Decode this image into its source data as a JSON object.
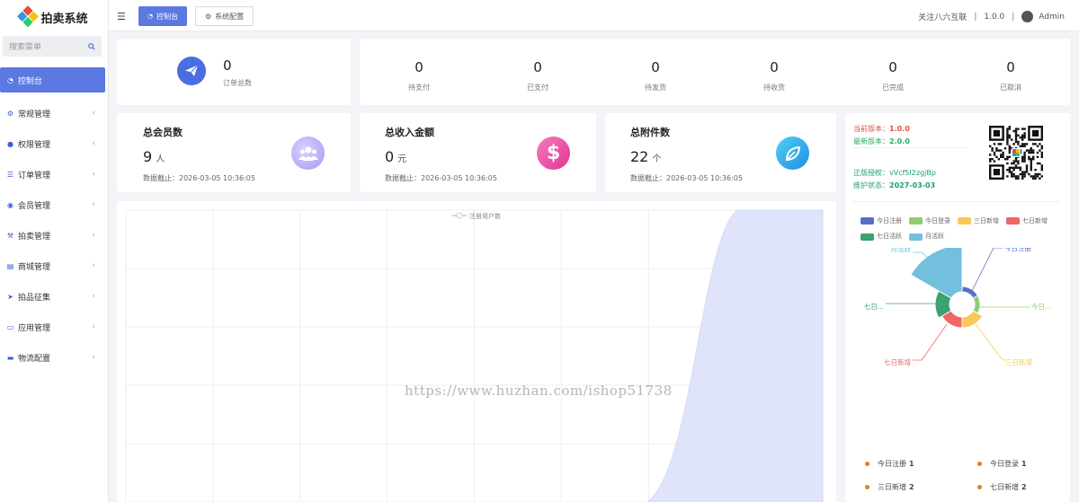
{
  "app": {
    "name": "拍卖系统"
  },
  "sidebar": {
    "search_placeholder": "搜索菜单",
    "items": [
      {
        "label": "控制台",
        "icon": "dashboard-icon",
        "active": true
      },
      {
        "label": "常规管理",
        "icon": "cogs-icon"
      },
      {
        "label": "权限管理",
        "icon": "users-icon"
      },
      {
        "label": "订单管理",
        "icon": "list-icon"
      },
      {
        "label": "会员管理",
        "icon": "user-circle-icon"
      },
      {
        "label": "拍卖管理",
        "icon": "gavel-icon"
      },
      {
        "label": "商城管理",
        "icon": "shopping-basket-icon"
      },
      {
        "label": "拍品征集",
        "icon": "paper-plane-icon"
      },
      {
        "label": "应用管理",
        "icon": "desktop-icon"
      },
      {
        "label": "物流配置",
        "icon": "truck-icon"
      }
    ]
  },
  "topbar": {
    "tabs": [
      {
        "label": "控制台",
        "active": true
      },
      {
        "label": "系统配置"
      }
    ],
    "follow": "关注八六互联",
    "version": "1.0.0",
    "user": "Admin"
  },
  "orders_card": {
    "value": "0",
    "label": "订单总数"
  },
  "order_stats": [
    {
      "value": "0",
      "label": "待支付"
    },
    {
      "value": "0",
      "label": "已支付"
    },
    {
      "value": "0",
      "label": "待发货"
    },
    {
      "value": "0",
      "label": "待收货"
    },
    {
      "value": "0",
      "label": "已完成"
    },
    {
      "value": "0",
      "label": "已取消"
    }
  ],
  "summary": [
    {
      "title": "总会员数",
      "value": "9",
      "unit": "人",
      "deadline": "数据截止：2026-03-05 10:36:05",
      "color": "#b3a6f5"
    },
    {
      "title": "总收入金额",
      "value": "0",
      "unit": "元",
      "deadline": "数据截止：2026-03-05 10:36:05",
      "color": "#e94fa0"
    },
    {
      "title": "总附件数",
      "value": "22",
      "unit": "个",
      "deadline": "数据截止：2026-03-05 10:36:05",
      "color": "#2aa7e6"
    }
  ],
  "version_info": {
    "current_label": "当前版本：",
    "current": "1.0.0",
    "latest_label": "最新版本：",
    "latest": "2.0.0",
    "license_label": "正版授权：",
    "license": "vVcf5l2zgjBp",
    "maint_label": "维护状态：",
    "maint": "2027-03-03"
  },
  "watermark": "https://www.huzhan.com/ishop51738",
  "chart_data": [
    {
      "type": "area",
      "series": [
        {
          "name": "注册用户数"
        }
      ]
    },
    {
      "type": "pie",
      "categories": [
        "今日注册",
        "今日登录",
        "三日新增",
        "七日新增",
        "七日活跃",
        "月活跃"
      ],
      "colors": [
        "#5470c6",
        "#91cc75",
        "#fac858",
        "#ee6666",
        "#3ba272",
        "#73c0de"
      ],
      "legend_placement": "top",
      "label_texts": [
        "今日注册",
        "今日...",
        "三日新增",
        "七日新增",
        "七日...",
        "月活跃"
      ]
    }
  ],
  "bottom_stats": [
    {
      "label": "今日注册",
      "value": "1"
    },
    {
      "label": "今日登录",
      "value": "1"
    },
    {
      "label": "三日新增",
      "value": "2"
    },
    {
      "label": "七日新增",
      "value": "2"
    }
  ]
}
